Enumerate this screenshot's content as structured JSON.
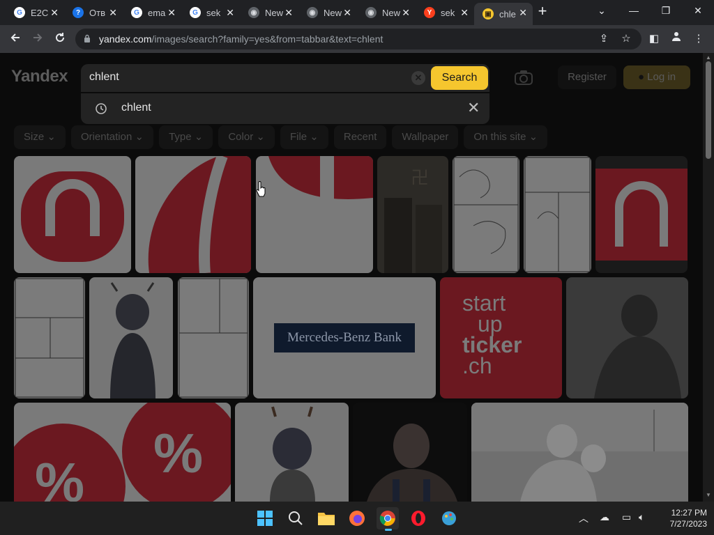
{
  "browser": {
    "tabs": [
      {
        "title": "E2C",
        "favicon": "google-g",
        "color": "#ffffff"
      },
      {
        "title": "Отв",
        "favicon": "question-mark",
        "color": "#1a73e8"
      },
      {
        "title": "ema",
        "favicon": "google-g",
        "color": "#ffffff"
      },
      {
        "title": "sek",
        "favicon": "google-g",
        "color": "#ffffff"
      },
      {
        "title": "New",
        "favicon": "chrome",
        "color": "#dadce0"
      },
      {
        "title": "New",
        "favicon": "chrome",
        "color": "#dadce0"
      },
      {
        "title": "New",
        "favicon": "chrome",
        "color": "#dadce0"
      },
      {
        "title": "sek",
        "favicon": "yandex-y",
        "color": "#fc3f1d"
      },
      {
        "title": "chle",
        "favicon": "yandex-images",
        "color": "#f5c62e",
        "active": true
      }
    ],
    "close_glyph": "✕",
    "new_tab_glyph": "+",
    "url_host": "yandex.com",
    "url_path": "/images/search?family=yes&from=tabbar&text=chlent"
  },
  "page": {
    "logo": "Yandex",
    "search": {
      "query": "chlent",
      "button_label": "Search",
      "suggestion": "chlent"
    },
    "register_label": "Register",
    "login_label": "Log in",
    "filters": [
      {
        "label": "Size",
        "dropdown": true
      },
      {
        "label": "Orientation",
        "dropdown": true
      },
      {
        "label": "Type",
        "dropdown": true
      },
      {
        "label": "Color",
        "dropdown": true
      },
      {
        "label": "File",
        "dropdown": true
      },
      {
        "label": "Recent",
        "dropdown": false
      },
      {
        "label": "Wallpaper",
        "dropdown": false
      },
      {
        "label": "On this site",
        "dropdown": true
      }
    ],
    "thumb_texts": {
      "bank": "Mercedes-Benz Bank",
      "startup": [
        "start",
        "up",
        "ticker",
        ".ch"
      ],
      "percent": "%"
    }
  },
  "taskbar": {
    "time": "12:27 PM",
    "date": "7/27/2023"
  },
  "colors": {
    "accent_yellow": "#f5c62e",
    "thumb_red": "#b81f2e",
    "dim_overlay": "rgba(0,0,0,0.55)"
  }
}
